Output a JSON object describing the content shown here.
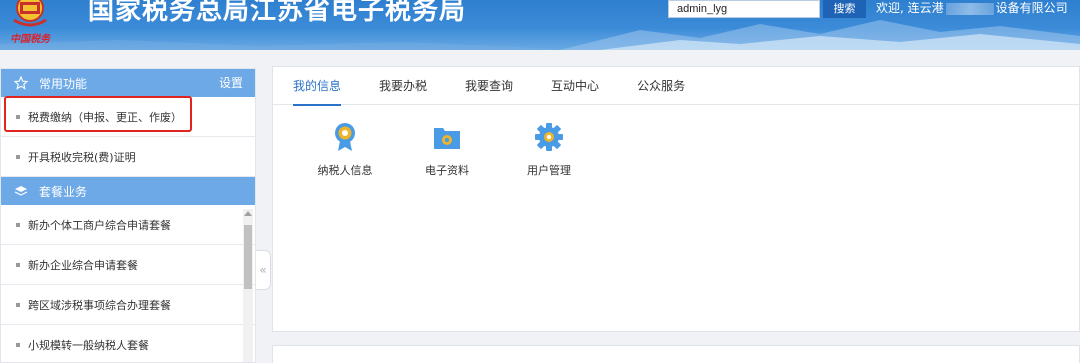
{
  "header": {
    "site_title": "国家税务总局江苏省电子税务局",
    "logo_script": "中国税务",
    "search_value": "admin_lyg",
    "search_button": "搜索",
    "welcome_prefix": "欢迎, 连云港",
    "welcome_suffix": "设备有限公司"
  },
  "sidebar": {
    "common_section_title": "常用功能",
    "settings_label": "设置",
    "common_items": [
      {
        "label": "税费缴纳（申报、更正、作废）"
      },
      {
        "label": "开具税收完税(费)证明"
      }
    ],
    "package_section_title": "套餐业务",
    "package_items": [
      {
        "label": "新办个体工商户综合申请套餐"
      },
      {
        "label": "新办企业综合申请套餐"
      },
      {
        "label": "跨区域涉税事项综合办理套餐"
      },
      {
        "label": "小规模转一般纳税人套餐"
      }
    ],
    "collapse_glyph": "«"
  },
  "main": {
    "tabs": [
      {
        "label": "我的信息",
        "active": true
      },
      {
        "label": "我要办税",
        "active": false
      },
      {
        "label": "我要查询",
        "active": false
      },
      {
        "label": "互动中心",
        "active": false
      },
      {
        "label": "公众服务",
        "active": false
      }
    ],
    "apps": [
      {
        "label": "纳税人信息",
        "icon": "taxpayer-badge-icon"
      },
      {
        "label": "电子资料",
        "icon": "folder-icon"
      },
      {
        "label": "用户管理",
        "icon": "gear-icon"
      }
    ]
  },
  "colors": {
    "header_blue": "#3b8bd8",
    "section_blue": "#6ea9e7",
    "accent": "#2b73c9",
    "highlight_red": "#e0241f",
    "icon_blue": "#4a9be6",
    "icon_gold": "#f0b429"
  }
}
